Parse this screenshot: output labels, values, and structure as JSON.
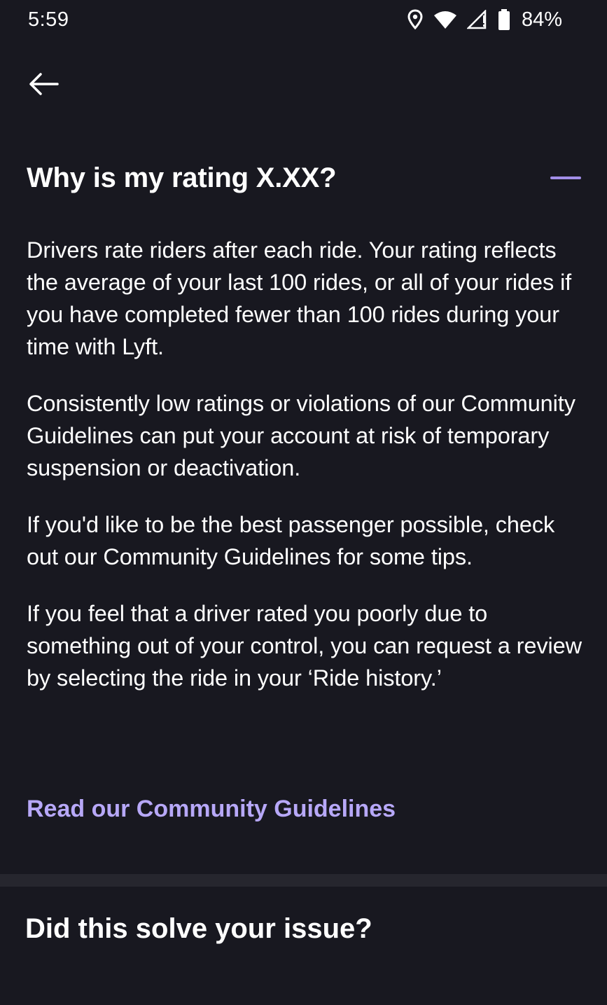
{
  "status_bar": {
    "time": "5:59",
    "battery": "84%",
    "icons": [
      "location-icon",
      "wifi-icon",
      "cell-signal-icon",
      "battery-icon"
    ]
  },
  "nav": {
    "back_icon": "arrow-left-icon"
  },
  "faq": {
    "title": "Why is my rating X.XX?",
    "toggle_icon": "minus-icon",
    "paragraphs": [
      "Drivers rate riders after each ride. Your rating reflects the average of your last 100 rides, or all of your rides if you have completed fewer than 100 rides during your time with Lyft.",
      "Consistently low ratings or violations of our Community Guidelines can put your account at risk of temporary suspension or deactivation.",
      "If you'd like to be the best passenger possible, check out our Community Guidelines for some tips.",
      "If you feel that a driver rated you poorly due to something out of your control, you can request a review by selecting the ride in your ‘Ride history.’"
    ],
    "link_label": "Read our Community Guidelines"
  },
  "feedback": {
    "title": "Did this solve your issue?"
  },
  "colors": {
    "background": "#181820",
    "accent": "#a28ee8",
    "link": "#b7a8f8",
    "divider": "#26262e"
  }
}
